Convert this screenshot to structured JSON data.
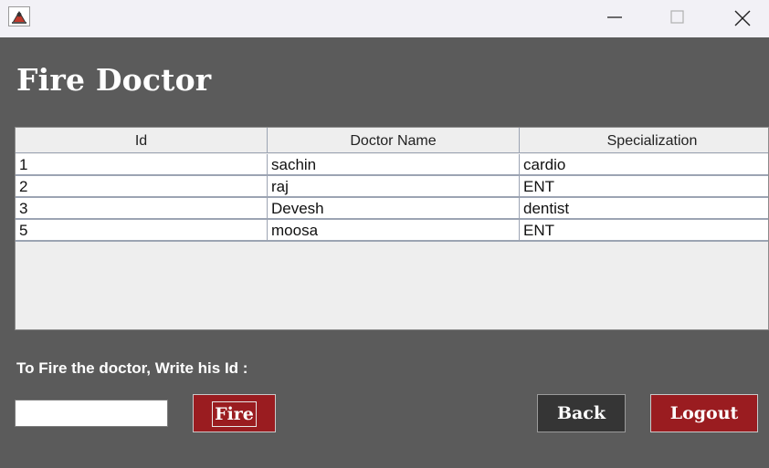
{
  "header": {
    "title": "Fire Doctor"
  },
  "table": {
    "columns": [
      "Id",
      "Doctor Name",
      "Specialization"
    ],
    "rows": [
      [
        "1",
        "sachin",
        "cardio"
      ],
      [
        "2",
        "raj",
        "ENT"
      ],
      [
        "3",
        "Devesh",
        "dentist"
      ],
      [
        "5",
        "moosa",
        "ENT"
      ]
    ]
  },
  "form": {
    "label": "To Fire the doctor, Write his Id :",
    "id_value": "",
    "fire_label": "Fire"
  },
  "actions": {
    "back_label": "Back",
    "logout_label": "Logout"
  },
  "colors": {
    "background": "#5b5b5b",
    "danger": "#9a1c20",
    "dark_button": "#353535"
  }
}
